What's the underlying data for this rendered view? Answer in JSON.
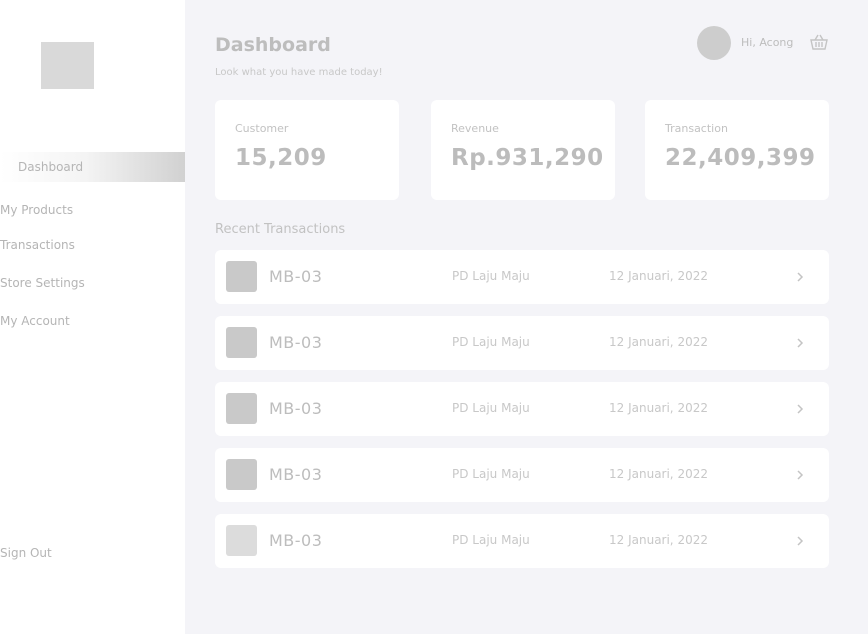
{
  "sidebar": {
    "items": [
      {
        "label": "Dashboard",
        "active": true
      },
      {
        "label": "My Products"
      },
      {
        "label": "Transactions"
      },
      {
        "label": "Store Settings"
      },
      {
        "label": "My Account"
      }
    ],
    "sign_out": "Sign Out"
  },
  "header": {
    "title": "Dashboard",
    "subtitle": "Look what you have made today!",
    "greeting": "Hi, Acong",
    "cart_icon": "basket-icon"
  },
  "stats": [
    {
      "label": "Customer",
      "value": "15,209"
    },
    {
      "label": "Revenue",
      "value": "Rp.931,290"
    },
    {
      "label": "Transaction",
      "value": "22,409,399"
    }
  ],
  "recent": {
    "title": "Recent Transactions",
    "rows": [
      {
        "id": "MB-03",
        "store": "PD Laju Maju",
        "date": "12 Januari, 2022"
      },
      {
        "id": "MB-03",
        "store": "PD Laju Maju",
        "date": "12 Januari, 2022"
      },
      {
        "id": "MB-03",
        "store": "PD Laju Maju",
        "date": "12 Januari, 2022"
      },
      {
        "id": "MB-03",
        "store": "PD Laju Maju",
        "date": "12 Januari, 2022"
      },
      {
        "id": "MB-03",
        "store": "PD Laju Maju",
        "date": "12 Januari, 2022"
      }
    ]
  },
  "colors": {
    "main_bg": "#f4f4f8",
    "card_bg": "#ffffff",
    "text_muted": "#bdbdbd",
    "thumb": "#c9c9c9"
  }
}
